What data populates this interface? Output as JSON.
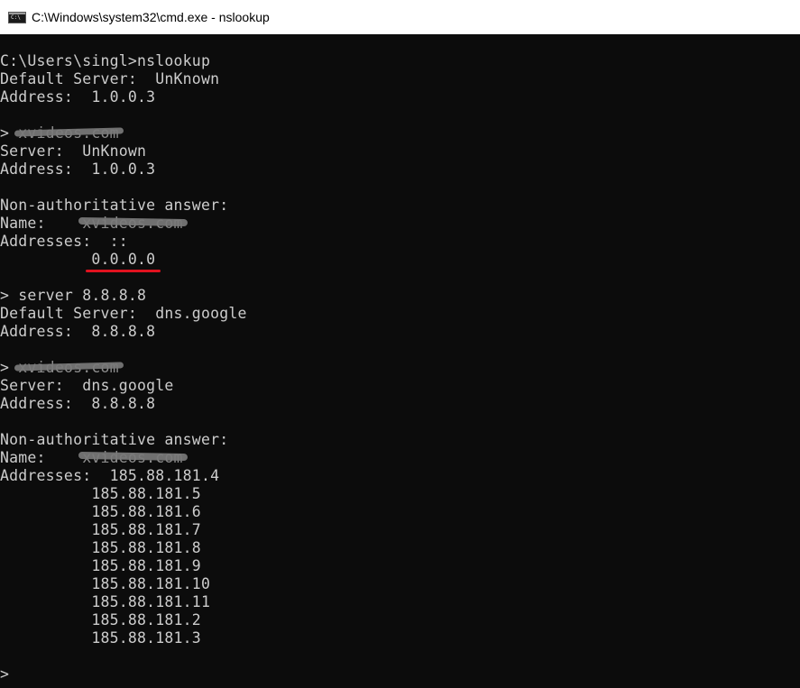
{
  "window": {
    "title": "C:\\Windows\\system32\\cmd.exe - nslookup",
    "icon": "cmd-window-icon",
    "icon_text": "C:\\"
  },
  "console": {
    "background": "#0c0c0c",
    "foreground": "#cccccc",
    "lines": [
      "C:\\Users\\singl>nslookup",
      "Default Server:  UnKnown",
      "Address:  1.0.0.3",
      "",
      "> xvideos.com",
      "Server:  UnKnown",
      "Address:  1.0.0.3",
      "",
      "Non-authoritative answer:",
      "Name:    xvideos.com",
      "Addresses:  ::",
      "          0.0.0.0",
      "",
      "> server 8.8.8.8",
      "Default Server:  dns.google",
      "Address:  8.8.8.8",
      "",
      "> xvideos.com",
      "Server:  dns.google",
      "Address:  8.8.8.8",
      "",
      "Non-authoritative answer:",
      "Name:    xvideos.com",
      "Addresses:  185.88.181.4",
      "          185.88.181.5",
      "          185.88.181.6",
      "          185.88.181.7",
      "          185.88.181.8",
      "          185.88.181.9",
      "          185.88.181.10",
      "          185.88.181.11",
      "          185.88.181.2",
      "          185.88.181.3",
      "",
      ">"
    ],
    "redacted_values": [
      "xvideos.com",
      "xvideos.com",
      "xvideos.com",
      "xvideos.com"
    ],
    "highlight_color": "#e0121f"
  }
}
